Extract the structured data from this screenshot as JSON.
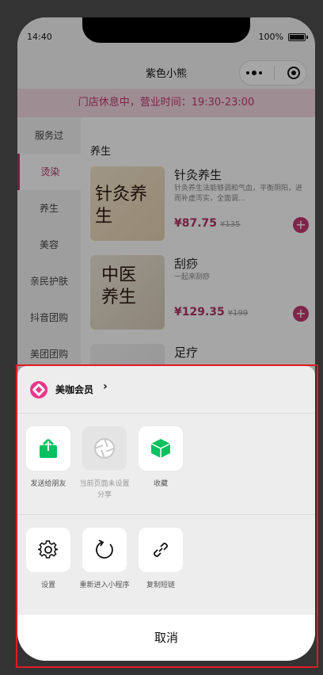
{
  "status": {
    "time": "14:40",
    "battery": "100%"
  },
  "navbar": {
    "title": "紫色小熊"
  },
  "notice": {
    "text": "门店休息中，营业时间：19:30-23:00"
  },
  "sidebar": {
    "items": [
      {
        "label": "服务过"
      },
      {
        "label": "烫染"
      },
      {
        "label": "养生"
      },
      {
        "label": "美容"
      },
      {
        "label": "亲民护肤"
      },
      {
        "label": "抖音团购"
      },
      {
        "label": "美团团购"
      }
    ],
    "active_index": 1
  },
  "content": {
    "section_title": "养生",
    "products": [
      {
        "name": "针灸养生",
        "desc": "针灸养生法能够调和气血，平衡阴阳，进而补虚泻实，全面调...",
        "price": "¥87.75",
        "orig": "¥135",
        "thumb_text": "针灸养生"
      },
      {
        "name": "刮痧",
        "desc": "一起来刮痧",
        "price": "¥129.35",
        "orig": "¥199",
        "thumb_text": "中医养生"
      },
      {
        "name": "足疗",
        "desc": "",
        "price": "",
        "orig": "",
        "thumb_text": ""
      }
    ]
  },
  "sheet": {
    "brand_name": "美咖会员",
    "brand_chevron": "›",
    "row1": [
      {
        "label": "发送给朋友",
        "icon": "share-icon",
        "color": "#07c160"
      },
      {
        "label": "当前页面未设置分享",
        "icon": "shutter-icon",
        "color": "#b8b8b8"
      },
      {
        "label": "收藏",
        "icon": "cube-icon",
        "color": "#07c160"
      }
    ],
    "row2": [
      {
        "label": "设置",
        "icon": "gear-icon"
      },
      {
        "label": "重新进入小程序",
        "icon": "refresh-icon"
      },
      {
        "label": "复制短链",
        "icon": "link-icon"
      }
    ],
    "cancel": "取消"
  },
  "colors": {
    "accent": "#c23a6f",
    "brand": "#e8368a",
    "highlight": "#e01b24"
  }
}
